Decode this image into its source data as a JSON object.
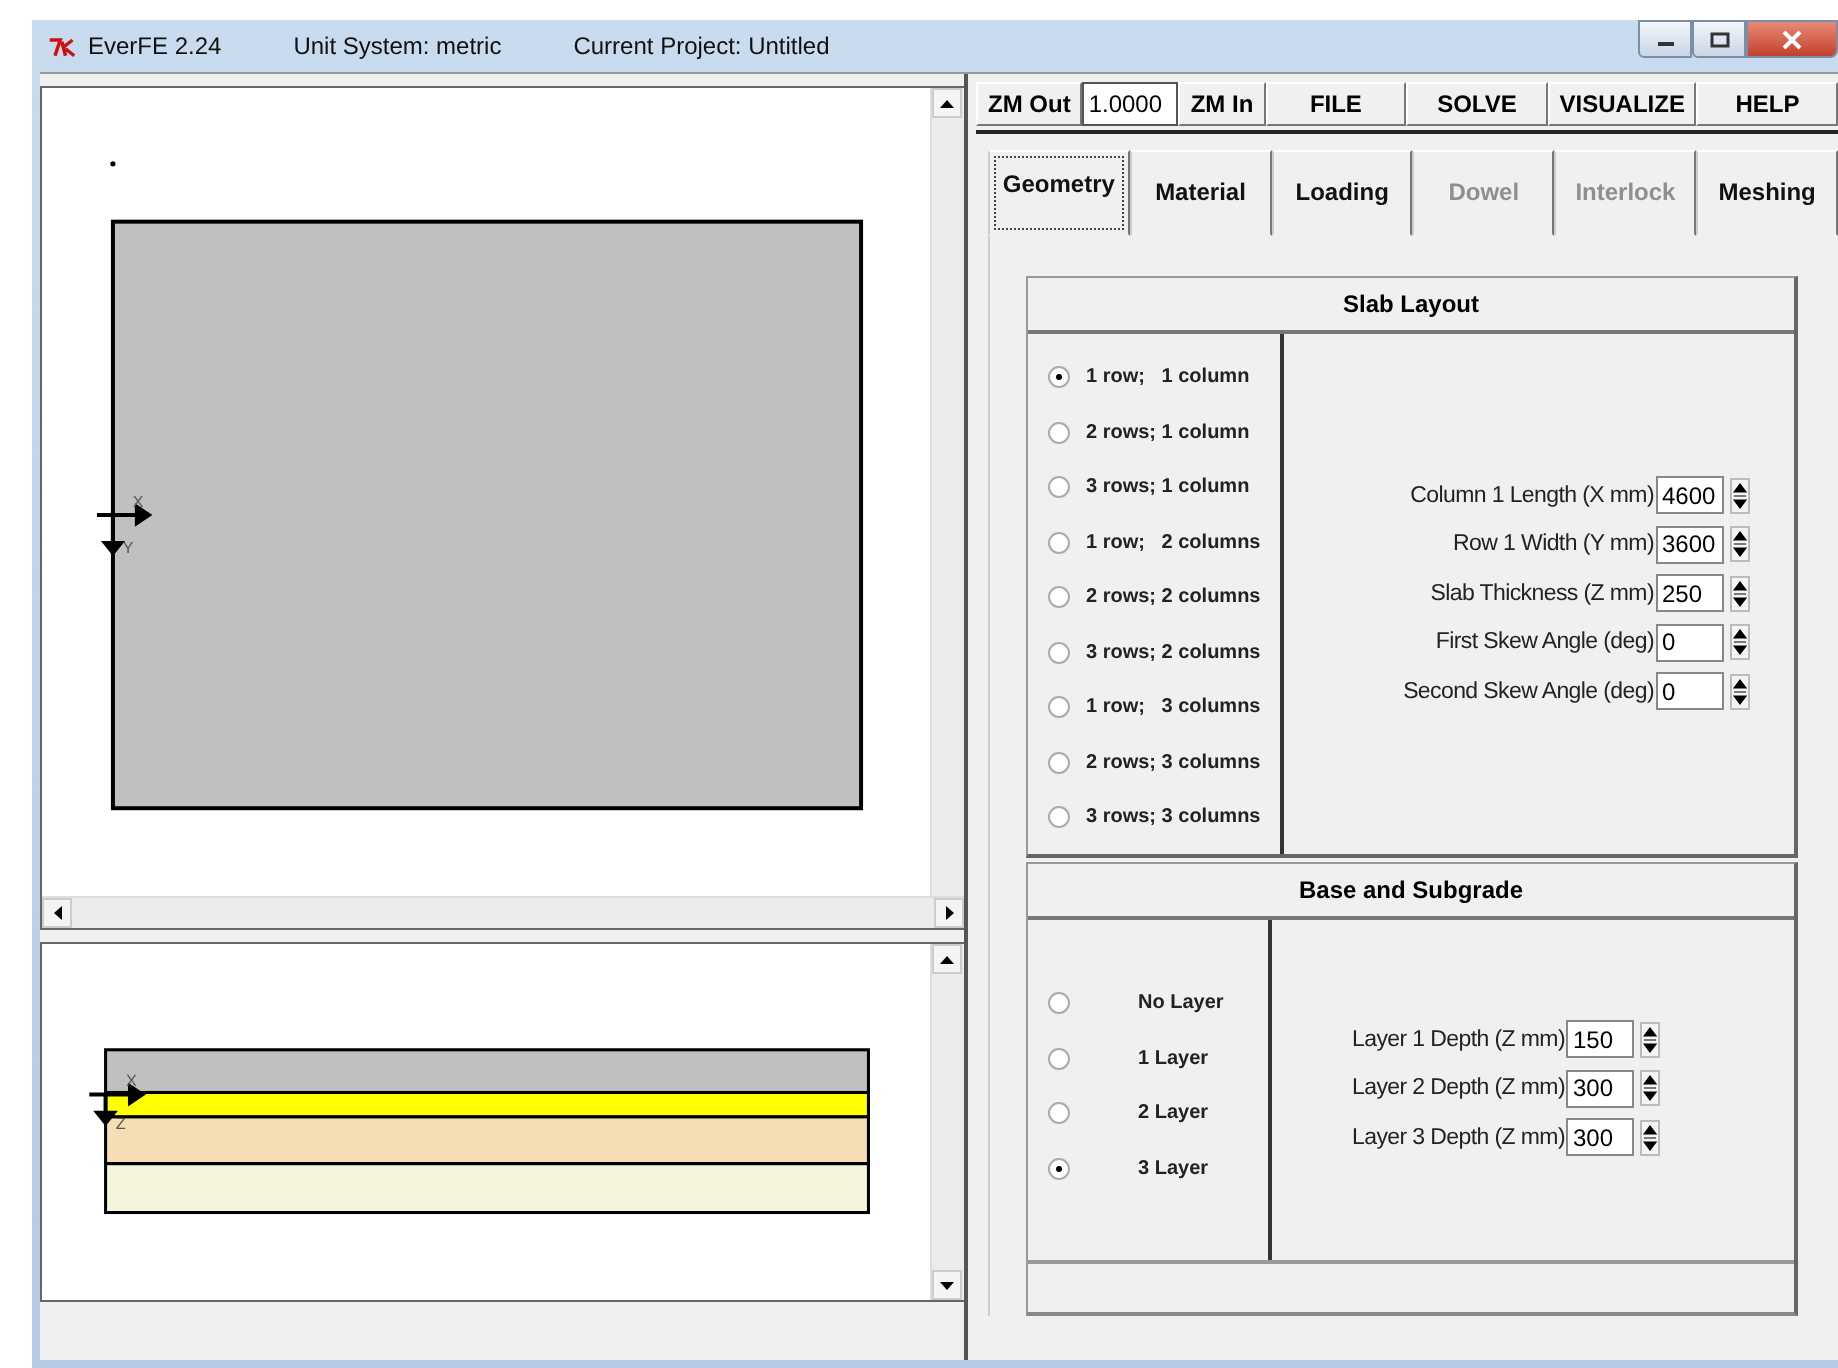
{
  "window": {
    "title": "EverFE 2.24",
    "unit_system": "Unit System: metric",
    "project": "Current Project: Untitled"
  },
  "plan_view": {
    "axis_x": "X",
    "axis_y": "Y"
  },
  "section_view": {
    "axis_x": "X",
    "axis_z": "Z",
    "layers": [
      {
        "color": "#c0c0c0"
      },
      {
        "color": "#ffff00"
      },
      {
        "color": "#f5deb3"
      },
      {
        "color": "#f5f5dc"
      }
    ]
  },
  "toolbar": {
    "zoom_out": "ZM Out",
    "zoom_value": "1.0000",
    "zoom_in": "ZM In",
    "menus": [
      "FILE",
      "SOLVE",
      "VISUALIZE",
      "HELP"
    ]
  },
  "tabs": [
    {
      "label": "Geometry",
      "selected": true,
      "disabled": false
    },
    {
      "label": "Material",
      "selected": false,
      "disabled": false
    },
    {
      "label": "Loading",
      "selected": false,
      "disabled": false
    },
    {
      "label": "Dowel",
      "selected": false,
      "disabled": true
    },
    {
      "label": "Interlock",
      "selected": false,
      "disabled": true
    },
    {
      "label": "Meshing",
      "selected": false,
      "disabled": false
    }
  ],
  "slab_layout": {
    "title": "Slab Layout",
    "options": [
      {
        "label": "1 row;   1 column",
        "selected": true
      },
      {
        "label": "2 rows; 1 column",
        "selected": false
      },
      {
        "label": "3 rows; 1 column",
        "selected": false
      },
      {
        "label": "1 row;   2 columns",
        "selected": false
      },
      {
        "label": "2 rows; 2 columns",
        "selected": false
      },
      {
        "label": "3 rows; 2 columns",
        "selected": false
      },
      {
        "label": "1 row;   3 columns",
        "selected": false
      },
      {
        "label": "2 rows; 3 columns",
        "selected": false
      },
      {
        "label": "3 rows; 3 columns",
        "selected": false
      }
    ],
    "fields": [
      {
        "label": "Column 1 Length (X mm)",
        "value": "4600"
      },
      {
        "label": "Row 1 Width (Y mm)",
        "value": "3600"
      },
      {
        "label": "Slab Thickness (Z mm)",
        "value": "250"
      },
      {
        "label": "First Skew Angle (deg)",
        "value": "0"
      },
      {
        "label": "Second Skew Angle (deg)",
        "value": "0"
      }
    ]
  },
  "base_subgrade": {
    "title": "Base and Subgrade",
    "options": [
      {
        "label": "No Layer",
        "selected": false
      },
      {
        "label": "1 Layer",
        "selected": false
      },
      {
        "label": "2 Layer",
        "selected": false
      },
      {
        "label": "3 Layer",
        "selected": true
      }
    ],
    "fields": [
      {
        "label": "Layer 1 Depth (Z mm)",
        "value": "150"
      },
      {
        "label": "Layer 2 Depth (Z mm)",
        "value": "300"
      },
      {
        "label": "Layer 3 Depth (Z mm)",
        "value": "300"
      }
    ]
  }
}
